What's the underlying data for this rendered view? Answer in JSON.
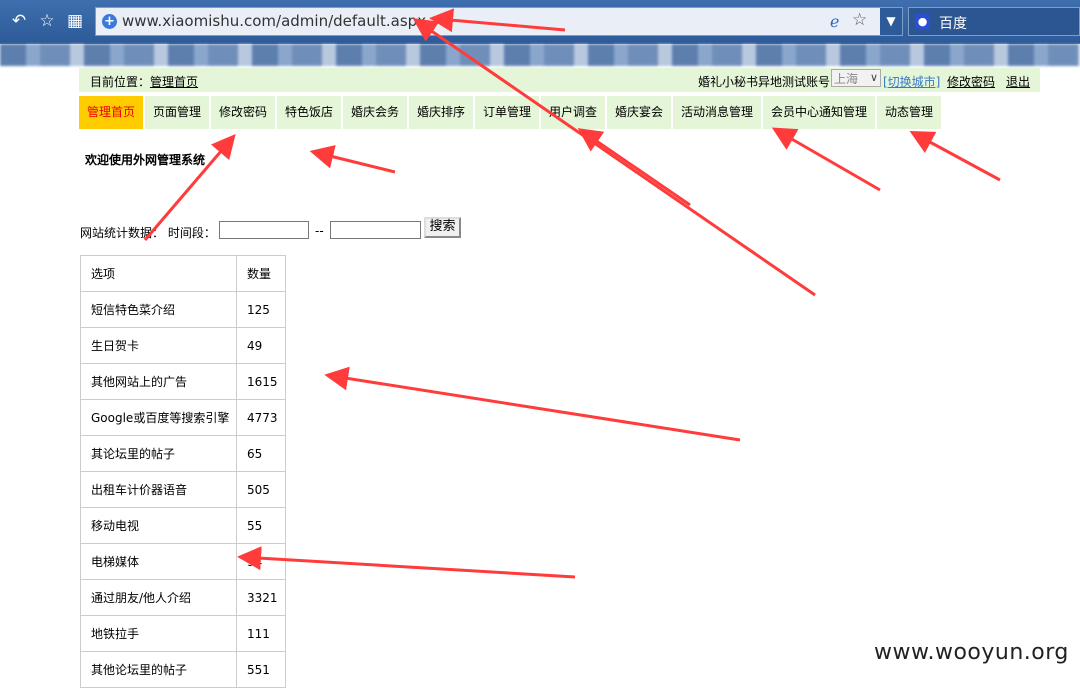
{
  "browser": {
    "url": "www.xiaomishu.com/admin/default.aspx",
    "search_engine": "百度",
    "icons": [
      "back-icon",
      "favorite-star-icon",
      "apps-grid-icon",
      "ie-compat-icon",
      "favorite-icon",
      "dropdown-icon",
      "baidu-icon"
    ]
  },
  "info_bar": {
    "location_label": "目前位置：",
    "location_link": "管理首页",
    "account_label": "婚礼小秘书异地测试账号",
    "city_selected": "上海",
    "switch_city": "[切换城市]",
    "change_password": "修改密码",
    "logout": "退出"
  },
  "nav": [
    {
      "label": "管理首页",
      "active": true
    },
    {
      "label": "页面管理"
    },
    {
      "label": "修改密码"
    },
    {
      "label": "特色饭店"
    },
    {
      "label": "婚庆会务"
    },
    {
      "label": "婚庆排序"
    },
    {
      "label": "订单管理"
    },
    {
      "label": "用户调查"
    },
    {
      "label": "婚庆宴会"
    },
    {
      "label": "活动消息管理"
    },
    {
      "label": "会员中心通知管理"
    },
    {
      "label": "动态管理"
    }
  ],
  "welcome": "欢迎使用外网管理系统",
  "stats": {
    "label": "网站统计数据： 时间段：",
    "separator": "--",
    "search_button": "搜索",
    "headers": [
      "选项",
      "数量"
    ],
    "rows": [
      [
        "短信特色菜介绍",
        "125"
      ],
      [
        "生日贺卡",
        "49"
      ],
      [
        "其他网站上的广告",
        "1615"
      ],
      [
        "Google或百度等搜索引擎",
        "4773"
      ],
      [
        "其论坛里的帖子",
        "65"
      ],
      [
        "出租车计价器语音",
        "505"
      ],
      [
        "移动电视",
        "55"
      ],
      [
        "电梯媒体",
        "94"
      ],
      [
        "通过朋友/他人介绍",
        "3321"
      ],
      [
        "地铁拉手",
        "111"
      ],
      [
        "其他论坛里的帖子",
        "551"
      ]
    ]
  },
  "watermark": "www.wooyun.org",
  "colors": {
    "chrome": "#2d5a98",
    "menu_bg": "#e5f5d7",
    "menu_active": "#ffcc00",
    "active_text": "#ee0000",
    "link_blue": "#3979c8",
    "annotation_red": "#ff3b3b"
  }
}
